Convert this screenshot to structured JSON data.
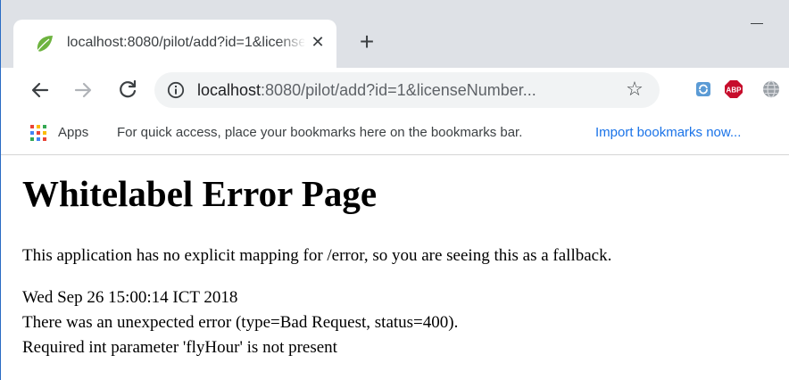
{
  "browser": {
    "tab": {
      "title": "localhost:8080/pilot/add?id=1&licenseNumber",
      "close_glyph": "✕"
    },
    "new_tab_glyph": "+",
    "address_bar": {
      "host": "localhost",
      "rest": ":8080/pilot/add?id=1&licenseNumber..."
    },
    "bookmark_star_glyph": "☆",
    "extensions": [
      {
        "name": "sync-extension-icon"
      },
      {
        "name": "adblock-plus-icon",
        "label": "ABP"
      },
      {
        "name": "globe-extension-icon"
      }
    ]
  },
  "bookmarks_bar": {
    "apps_label": "Apps",
    "hint": "For quick access, place your bookmarks here on the bookmarks bar.",
    "import_link": "Import bookmarks now..."
  },
  "page": {
    "title": "Whitelabel Error Page",
    "description": "This application has no explicit mapping for /error, so you are seeing this as a fallback.",
    "timestamp": "Wed Sep 26 15:00:14 ICT 2018",
    "error_line": "There was an unexpected error (type=Bad Request, status=400).",
    "detail": "Required int parameter 'flyHour' is not present"
  },
  "colors": {
    "tab_strip": "#dee1e6",
    "omnibox": "#f1f3f4",
    "link": "#1a73e8",
    "spring_green": "#6db33f",
    "abp_red": "#c70d2c"
  }
}
